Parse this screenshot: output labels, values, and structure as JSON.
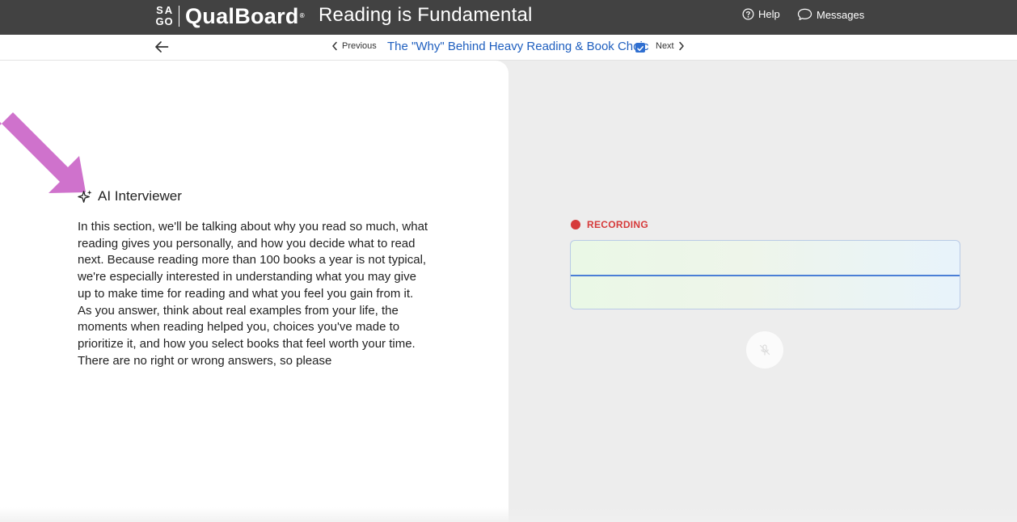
{
  "header": {
    "logo_mark": [
      "S",
      "A",
      "G",
      "O"
    ],
    "brand": "QualBoard",
    "brand_mark": "®",
    "title": "Reading is Fundamental",
    "help_label": "Help",
    "messages_label": "Messages",
    "background_color": "#424242"
  },
  "subnav": {
    "previous_label": "Previous",
    "section_title": "The \"Why\" Behind Heavy Reading & Book Choic",
    "next_label": "Next",
    "link_color": "#1f5fbf"
  },
  "left_panel": {
    "heading": "AI Interviewer",
    "prompt": "In this section, we'll be talking about why you read so much, what reading gives you personally, and how you decide what to read next. Because reading more than 100 books a year is not typical, we're especially interested in understanding what you may give up to make time for reading and what you feel you gain from it. As you answer, think about real examples from your life, the moments when reading helped you, choices you've made to prioritize it, and how you select books that feel worth your time. There are no right or wrong answers, so please",
    "annotation_arrow_color": "#cf72cc"
  },
  "right_panel": {
    "status_label": "RECORDING",
    "status_color": "#d63a3a",
    "mic_icon": "microphone-muted-icon"
  }
}
